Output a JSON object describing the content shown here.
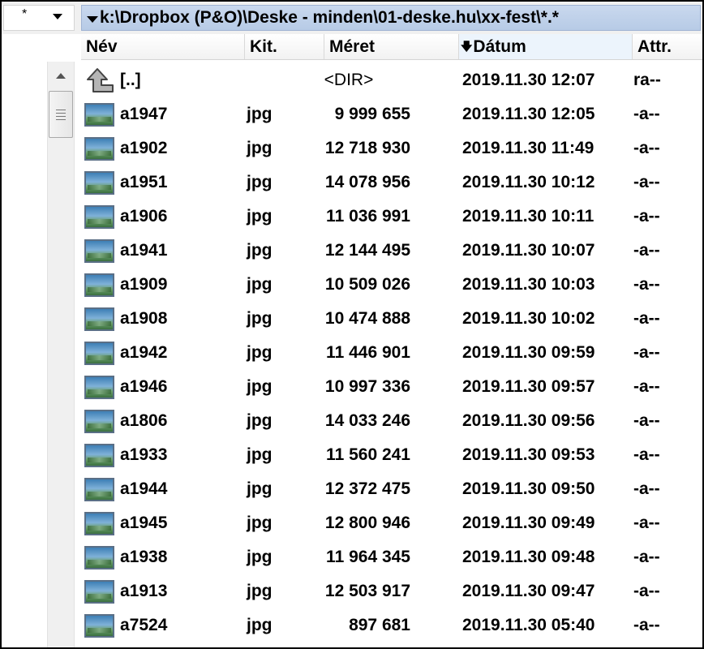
{
  "filter": {
    "mask": "*"
  },
  "path": {
    "text": "k:\\Dropbox (P&O)\\Deske - minden\\01-deske.hu\\xx-fest\\*.*"
  },
  "columns": {
    "name": "Név",
    "ext": "Kit.",
    "size": "Méret",
    "date": "Dátum",
    "attr": "Attr.",
    "sorted_by": "date",
    "sort_direction": "descending"
  },
  "parent": {
    "name": "[..]",
    "size": "<DIR>",
    "date": "2019.11.30 12:07",
    "attr": "ra--",
    "icon": "up-folder-icon"
  },
  "files": [
    {
      "name": "a1947",
      "ext": "jpg",
      "size": "9 999 655",
      "date": "2019.11.30 12:05",
      "attr": "-a--"
    },
    {
      "name": "a1902",
      "ext": "jpg",
      "size": "12 718 930",
      "date": "2019.11.30 11:49",
      "attr": "-a--"
    },
    {
      "name": "a1951",
      "ext": "jpg",
      "size": "14 078 956",
      "date": "2019.11.30 10:12",
      "attr": "-a--"
    },
    {
      "name": "a1906",
      "ext": "jpg",
      "size": "11 036 991",
      "date": "2019.11.30 10:11",
      "attr": "-a--"
    },
    {
      "name": "a1941",
      "ext": "jpg",
      "size": "12 144 495",
      "date": "2019.11.30 10:07",
      "attr": "-a--"
    },
    {
      "name": "a1909",
      "ext": "jpg",
      "size": "10 509 026",
      "date": "2019.11.30 10:03",
      "attr": "-a--"
    },
    {
      "name": "a1908",
      "ext": "jpg",
      "size": "10 474 888",
      "date": "2019.11.30 10:02",
      "attr": "-a--"
    },
    {
      "name": "a1942",
      "ext": "jpg",
      "size": "11 446 901",
      "date": "2019.11.30 09:59",
      "attr": "-a--"
    },
    {
      "name": "a1946",
      "ext": "jpg",
      "size": "10 997 336",
      "date": "2019.11.30 09:57",
      "attr": "-a--"
    },
    {
      "name": "a1806",
      "ext": "jpg",
      "size": "14 033 246",
      "date": "2019.11.30 09:56",
      "attr": "-a--"
    },
    {
      "name": "a1933",
      "ext": "jpg",
      "size": "11 560 241",
      "date": "2019.11.30 09:53",
      "attr": "-a--"
    },
    {
      "name": "a1944",
      "ext": "jpg",
      "size": "12 372 475",
      "date": "2019.11.30 09:50",
      "attr": "-a--"
    },
    {
      "name": "a1945",
      "ext": "jpg",
      "size": "12 800 946",
      "date": "2019.11.30 09:49",
      "attr": "-a--"
    },
    {
      "name": "a1938",
      "ext": "jpg",
      "size": "11 964 345",
      "date": "2019.11.30 09:48",
      "attr": "-a--"
    },
    {
      "name": "a1913",
      "ext": "jpg",
      "size": "12 503 917",
      "date": "2019.11.30 09:47",
      "attr": "-a--"
    },
    {
      "name": "a7524",
      "ext": "jpg",
      "size": "897 681",
      "date": "2019.11.30 05:40",
      "attr": "-a--"
    }
  ],
  "colors": {
    "path_bar": "#c3d3ea",
    "sorted_column": "#ecf4fc",
    "scrollbar": "#f0f0f0"
  },
  "icons": {
    "file": "image-file-icon",
    "parent": "up-folder-icon",
    "scroll_up": "scroll-up-arrow-icon",
    "dropdown": "chevron-down-icon"
  }
}
